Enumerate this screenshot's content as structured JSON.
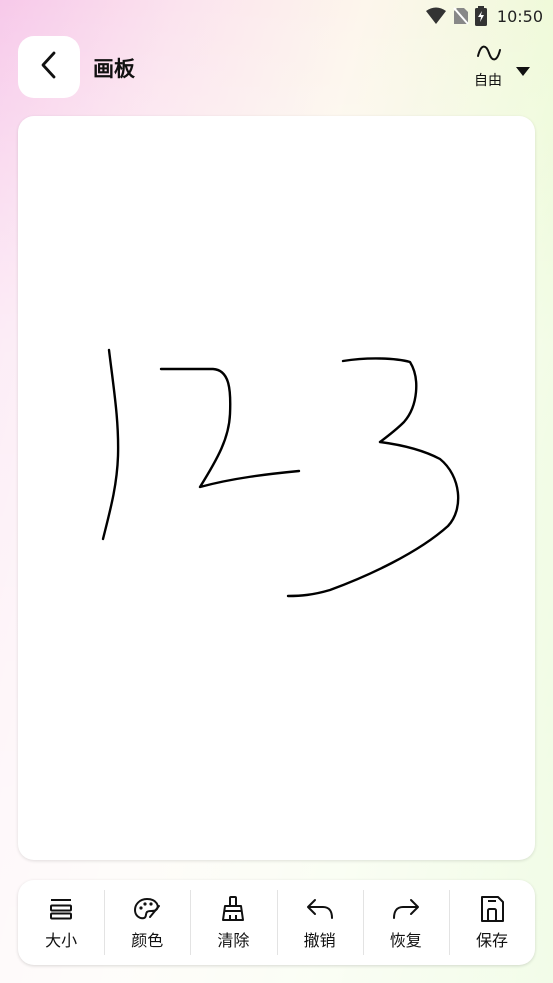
{
  "status_bar": {
    "time": "10:50",
    "icons": [
      "wifi-icon",
      "no-sim-icon",
      "battery-charging-icon"
    ]
  },
  "header": {
    "back_icon": "chevron-left-icon",
    "title": "画板",
    "mode": {
      "icon": "free-draw-wave-icon",
      "label": "自由",
      "dropdown_icon": "caret-down-icon"
    }
  },
  "canvas": {
    "content": "handwritten strokes reading 123",
    "stroke_color": "#000000",
    "background": "#ffffff"
  },
  "toolbar": {
    "items": [
      {
        "label": "大小",
        "icon": "size-lines-icon"
      },
      {
        "label": "颜色",
        "icon": "palette-icon"
      },
      {
        "label": "清除",
        "icon": "broom-icon"
      },
      {
        "label": "撤销",
        "icon": "undo-icon"
      },
      {
        "label": "恢复",
        "icon": "redo-icon"
      },
      {
        "label": "保存",
        "icon": "save-icon"
      }
    ]
  },
  "colors": {
    "gradient_left": "#f7c9ea",
    "gradient_right": "#ccf5a6",
    "card": "#ffffff",
    "text": "#111111"
  }
}
